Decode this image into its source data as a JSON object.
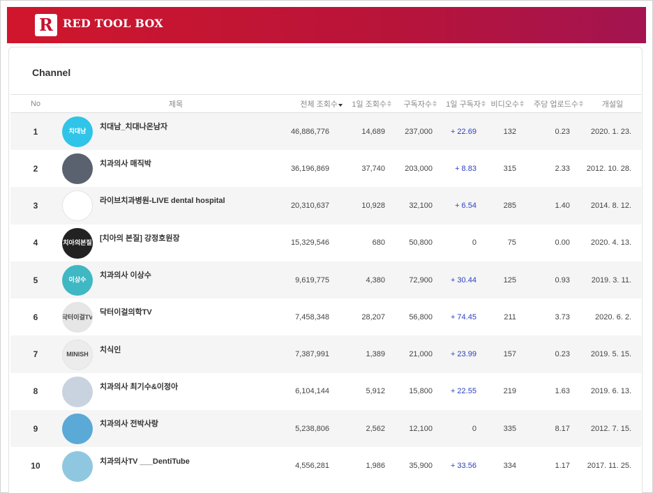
{
  "brand": {
    "logo_letter": "R",
    "name": "RED TOOL BOX"
  },
  "section_title": "Channel",
  "columns": {
    "no": "No",
    "title": "제목",
    "total_views": "전체 조회수",
    "daily_views": "1일 조회수",
    "subscribers": "구독자수",
    "daily_subs": "1일 구독자",
    "videos": "비디오수",
    "weekly_uploads": "주당 업로드수",
    "opened": "개설일"
  },
  "rows": [
    {
      "no": "1",
      "name": "치대남_치대나온남자",
      "total_views": "46,886,776",
      "daily_views": "14,689",
      "subscribers": "237,000",
      "daily_subs": "+ 22.69",
      "videos": "132",
      "weekly_uploads": "0.23",
      "opened": "2020. 1. 23.",
      "avatar_text": "치대남",
      "avatar_color": "#2fc4e8"
    },
    {
      "no": "2",
      "name": "치과의사 매직박",
      "total_views": "36,196,869",
      "daily_views": "37,740",
      "subscribers": "203,000",
      "daily_subs": "+ 8.83",
      "videos": "315",
      "weekly_uploads": "2.33",
      "opened": "2012. 10. 28.",
      "avatar_text": "",
      "avatar_color": "#5a6270"
    },
    {
      "no": "3",
      "name": "라이브치과병원-LIVE dental hospital",
      "total_views": "20,310,637",
      "daily_views": "10,928",
      "subscribers": "32,100",
      "daily_subs": "+ 6.54",
      "videos": "285",
      "weekly_uploads": "1.40",
      "opened": "2014. 8. 12.",
      "avatar_text": "",
      "avatar_color": "#ffffff"
    },
    {
      "no": "4",
      "name": "[치아의 본질] 강정호원장",
      "total_views": "15,329,546",
      "daily_views": "680",
      "subscribers": "50,800",
      "daily_subs": "0",
      "videos": "75",
      "weekly_uploads": "0.00",
      "opened": "2020. 4. 13.",
      "avatar_text": "치아의본질",
      "avatar_color": "#222222"
    },
    {
      "no": "5",
      "name": "치과의사 이상수",
      "total_views": "9,619,775",
      "daily_views": "4,380",
      "subscribers": "72,900",
      "daily_subs": "+ 30.44",
      "videos": "125",
      "weekly_uploads": "0.93",
      "opened": "2019. 3. 11.",
      "avatar_text": "이상수",
      "avatar_color": "#3fb8c4"
    },
    {
      "no": "6",
      "name": "닥터이걸의학TV",
      "total_views": "7,458,348",
      "daily_views": "28,207",
      "subscribers": "56,800",
      "daily_subs": "+ 74.45",
      "videos": "211",
      "weekly_uploads": "3.73",
      "opened": "2020. 6. 2.",
      "avatar_text": "닥터이걸TV",
      "avatar_color": "#e6e6e6"
    },
    {
      "no": "7",
      "name": "치식인",
      "total_views": "7,387,991",
      "daily_views": "1,389",
      "subscribers": "21,000",
      "daily_subs": "+ 23.99",
      "videos": "157",
      "weekly_uploads": "0.23",
      "opened": "2019. 5. 15.",
      "avatar_text": "MINISH",
      "avatar_color": "#ececec"
    },
    {
      "no": "8",
      "name": "치과의사 최기수&이정아",
      "total_views": "6,104,144",
      "daily_views": "5,912",
      "subscribers": "15,800",
      "daily_subs": "+ 22.55",
      "videos": "219",
      "weekly_uploads": "1.63",
      "opened": "2019. 6. 13.",
      "avatar_text": "",
      "avatar_color": "#c9d3e0"
    },
    {
      "no": "9",
      "name": "치과의사 전박사랑",
      "total_views": "5,238,806",
      "daily_views": "2,562",
      "subscribers": "12,100",
      "daily_subs": "0",
      "videos": "335",
      "weekly_uploads": "8.17",
      "opened": "2012. 7. 15.",
      "avatar_text": "",
      "avatar_color": "#5aa9d6"
    },
    {
      "no": "10",
      "name": "치과의사TV ___DentiTube",
      "total_views": "4,556,281",
      "daily_views": "1,986",
      "subscribers": "35,900",
      "daily_subs": "+ 33.56",
      "videos": "334",
      "weekly_uploads": "1.17",
      "opened": "2017. 11. 25.",
      "avatar_text": "",
      "avatar_color": "#8fc7e0"
    }
  ]
}
